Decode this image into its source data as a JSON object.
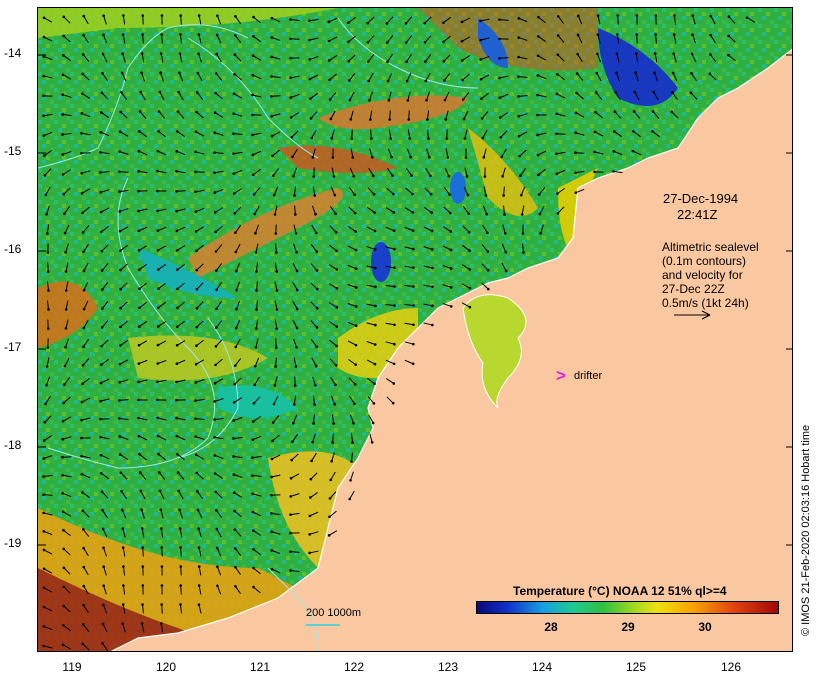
{
  "map": {
    "lat_labels": [
      "-14",
      "-15",
      "-16",
      "-17",
      "-18",
      "-19"
    ],
    "lon_labels": [
      "119",
      "120",
      "121",
      "122",
      "123",
      "124",
      "125",
      "126"
    ],
    "land_color": "#f9c8a0",
    "coast_color": "#ffffff",
    "contour_color": "#9be8e8",
    "arrow_color": "#000000"
  },
  "annotation": {
    "date": "27-Dec-1994",
    "time": "22:41Z",
    "lines": [
      "Altimetric sealevel",
      "(0.1m contours)",
      "and velocity for",
      "27-Dec 22Z",
      "0.5m/s (1kt 24h)"
    ]
  },
  "legend": {
    "title": "Temperature (°C) NOAA 12 51% ql>=4",
    "ticks": [
      "28",
      "29",
      "30"
    ],
    "colors": [
      "#0a0a7a",
      "#1030c8",
      "#18a0e0",
      "#20c890",
      "#30c040",
      "#a0d820",
      "#f0e010",
      "#f8a000",
      "#e04010",
      "#a00808"
    ]
  },
  "scale_bar": {
    "label": "200  1000m"
  },
  "drifter": {
    "symbol": ">",
    "label": "drifter"
  },
  "credit": "© IMOS 21-Feb-2020 02:03:16 Hobart time"
}
